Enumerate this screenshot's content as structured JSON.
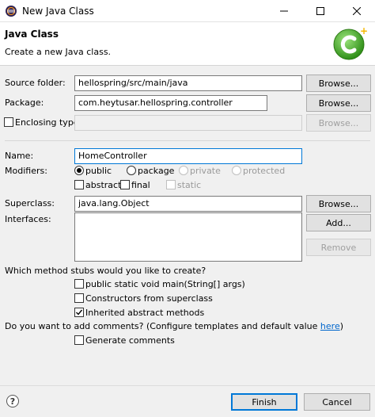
{
  "window": {
    "title": "New Java Class",
    "minimize_icon": "minimize-icon",
    "maximize_icon": "maximize-icon",
    "close_icon": "close-icon"
  },
  "header": {
    "title": "Java Class",
    "description": "Create a new Java class.",
    "logo_icon": "new-class-wizard-icon",
    "accent": "#4caf2a"
  },
  "source_folder": {
    "label": "Source folder:",
    "value": "hellospring/src/main/java",
    "browse": "Browse..."
  },
  "package": {
    "label": "Package:",
    "value": "com.heytusar.hellospring.controller",
    "browse": "Browse..."
  },
  "enclosing": {
    "label": "Enclosing type:",
    "checked": false,
    "value": "",
    "browse": "Browse..."
  },
  "name": {
    "label": "Name:",
    "value": "HomeController"
  },
  "modifiers": {
    "label": "Modifiers:",
    "public": "public",
    "package": "package",
    "private": "private",
    "protected": "protected",
    "abstract": "abstract",
    "final": "final",
    "static": "static",
    "selected": "public"
  },
  "superclass": {
    "label": "Superclass:",
    "value": "java.lang.Object",
    "browse": "Browse..."
  },
  "interfaces": {
    "label": "Interfaces:",
    "add": "Add...",
    "remove": "Remove"
  },
  "stubs": {
    "question": "Which method stubs would you like to create?",
    "main": "public static void main(String[] args)",
    "constructors": "Constructors from superclass",
    "inherited": "Inherited abstract methods",
    "main_checked": false,
    "constructors_checked": false,
    "inherited_checked": true
  },
  "comments": {
    "question": "Do you want to add comments? (Configure templates and default value ",
    "link": "here",
    "close_paren": ")",
    "generate": "Generate comments",
    "generate_checked": false
  },
  "footer": {
    "help_icon": "help-icon",
    "help_glyph": "?",
    "finish": "Finish",
    "cancel": "Cancel"
  }
}
